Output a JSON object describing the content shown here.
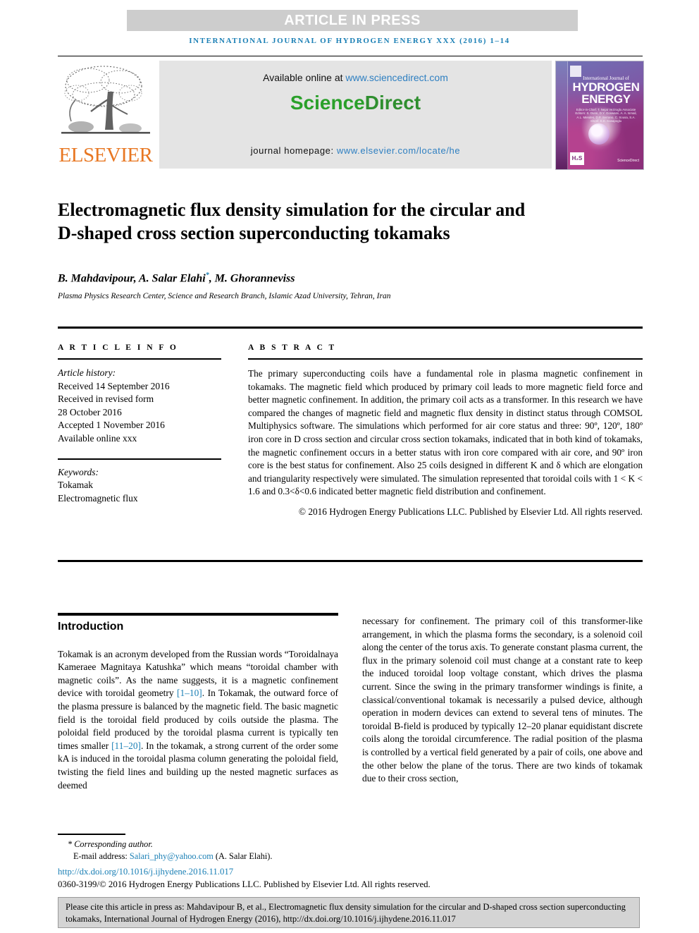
{
  "banner": {
    "text": "ARTICLE IN PRESS"
  },
  "running_head": "INTERNATIONAL JOURNAL OF HYDROGEN ENERGY XXX (2016) 1–14",
  "masthead": {
    "elsevier_word": "ELSEVIER",
    "available_prefix": "Available online at ",
    "available_url": "www.sciencedirect.com",
    "sciencedirect_part1": "Science",
    "sciencedirect_part2": "Direct",
    "homepage_label": "journal homepage: ",
    "homepage_url": "www.elsevier.com/locate/he",
    "cover": {
      "line_small": "International Journal of",
      "line_1": "HYDROGEN",
      "line_2": "ENERGY",
      "editors": "Editor-in-Chief: T. Nejat Veziroglu   Associate Editors: S. Dunn, D.Y. Goswami, A. A. Ismail, A.L. Mendes, D.P. Serrano, C. Sousa, S.A. Sherif, E.E. Kasapoglu",
      "hes_badge": "H₂S",
      "sciencedirect_badge": "ScienceDirect"
    }
  },
  "title": "Electromagnetic flux density simulation for the circular and D-shaped cross section superconducting tokamaks",
  "authors": {
    "list": "B. Mahdavipour, A. Salar Elahi",
    "marker": "*",
    "list_tail": ", M. Ghoranneviss",
    "affiliation": "Plasma Physics Research Center, Science and Research Branch, Islamic Azad University, Tehran, Iran"
  },
  "article_info": {
    "label": "A R T I C L E    I N F O",
    "history_heading": "Article history:",
    "history_lines": [
      "Received 14 September 2016",
      "Received in revised form",
      "28 October 2016",
      "Accepted 1 November 2016",
      "Available online xxx"
    ],
    "keywords_heading": "Keywords:",
    "keywords": [
      "Tokamak",
      "Electromagnetic flux"
    ]
  },
  "abstract": {
    "label": "A B S T R A C T",
    "text": "The primary superconducting coils have a fundamental role in plasma magnetic confinement in tokamaks. The magnetic field which produced by primary coil leads to more magnetic field force and better magnetic confinement. In addition, the primary coil acts as a transformer. In this research we have compared the changes of magnetic field and magnetic flux density in distinct status through COMSOL Multiphysics software. The simulations which performed for air core status and three: 90º, 120º, 180º iron core in D cross section and circular cross section tokamaks, indicated that in both kind of tokamaks, the magnetic confinement occurs in a better status with iron core compared with air core, and 90º iron core is the best status for confinement. Also 25 coils designed in different K and δ which are elongation and triangularity respectively were simulated. The simulation represented that toroidal coils with 1 < K < 1.6 and 0.3<δ<0.6 indicated better magnetic field distribution and confinement.",
    "copyright": "© 2016 Hydrogen Energy Publications LLC. Published by Elsevier Ltd. All rights reserved."
  },
  "body": {
    "intro_heading": "Introduction",
    "left_p1_a": "Tokamak is an acronym developed from the Russian words “Toroidalnaya Kameraee Magnitaya Katushka” which means “toroidal chamber with magnetic coils”. As the name suggests, it is a magnetic confinement device with toroidal geometry ",
    "left_ref1": "[1–10]",
    "left_p1_b": ". In Tokamak, the outward force of the plasma pressure is balanced by the magnetic field. The basic magnetic field is the toroidal field produced by coils outside the plasma. The poloidal field produced by the toroidal plasma current is typically ten times smaller ",
    "left_ref2": "[11–20]",
    "left_p1_c": ". In the tokamak, a strong current of the order some kA is induced in the toroidal plasma column generating the poloidal field, twisting the field lines and building up the nested magnetic surfaces as deemed",
    "right_p1": "necessary for confinement. The primary coil of this transformer-like arrangement, in which the plasma forms the secondary, is a solenoid coil along the center of the torus axis. To generate constant plasma current, the flux in the primary solenoid coil must change at a constant rate to keep the induced toroidal loop voltage constant, which drives the plasma current. Since the swing in the primary transformer windings is finite, a classical/conventional tokamak is necessarily a pulsed device, although operation in modern devices can extend to several tens of minutes. The toroidal B-field is produced by typically 12–20 planar equidistant discrete coils along the toroidal circumference. The radial position of the plasma is controlled by a vertical field generated by a pair of coils, one above and the other below the plane of the torus. There are two kinds of tokamak due to their cross section,"
  },
  "footer": {
    "corresponding": "* Corresponding author.",
    "email_label": "E-mail address: ",
    "email": "Salari_phy@yahoo.com",
    "email_suffix": " (A. Salar Elahi).",
    "doi": "http://dx.doi.org/10.1016/j.ijhydene.2016.11.017",
    "issn": "0360-3199/© 2016 Hydrogen Energy Publications LLC. Published by Elsevier Ltd. All rights reserved.",
    "cite_notice": "Please cite this article in press as: Mahdavipour B, et al., Electromagnetic flux density simulation for the circular and D-shaped cross section superconducting tokamaks, International Journal of Hydrogen Energy (2016), http://dx.doi.org/10.1016/j.ijhydene.2016.11.017"
  },
  "colors": {
    "accent_blue": "#1a7fb5",
    "elsevier_orange": "#e87722",
    "sciencedirect_green": "#2aa02a",
    "banner_gray": "#cdcdcd",
    "band_gray": "#e4e4e4",
    "cite_box_gray": "#d4d4d4"
  }
}
